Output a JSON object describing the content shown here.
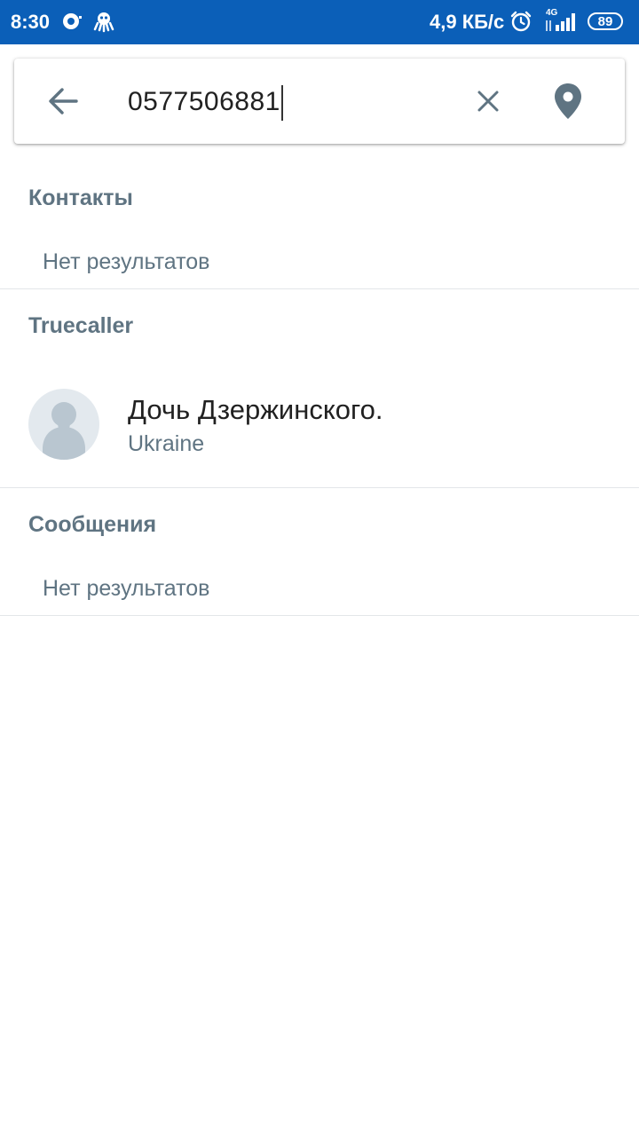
{
  "status_bar": {
    "time": "8:30",
    "network_speed": "4,9 КБ/с",
    "network_type": "4G",
    "battery": "89",
    "icons": [
      "camera-icon",
      "octopus-icon",
      "alarm-icon",
      "signal-icon",
      "battery-icon"
    ]
  },
  "search": {
    "query": "0577506881",
    "back_icon": "arrow-left-icon",
    "clear_icon": "close-icon",
    "location_icon": "location-pin-icon"
  },
  "sections": [
    {
      "title": "Контакты",
      "empty_text": "Нет результатов"
    },
    {
      "title": "Truecaller",
      "results": [
        {
          "name": "Дочь Дзержинского.",
          "subtitle": "Ukraine",
          "avatar_icon": "default-avatar-icon"
        }
      ]
    },
    {
      "title": "Сообщения",
      "empty_text": "Нет результатов"
    }
  ],
  "colors": {
    "status_bar": "#0b5fb8",
    "section_title": "#5f7482",
    "primary_text": "#212121",
    "divider": "#e3e6e9",
    "icon": "#5f7482"
  }
}
